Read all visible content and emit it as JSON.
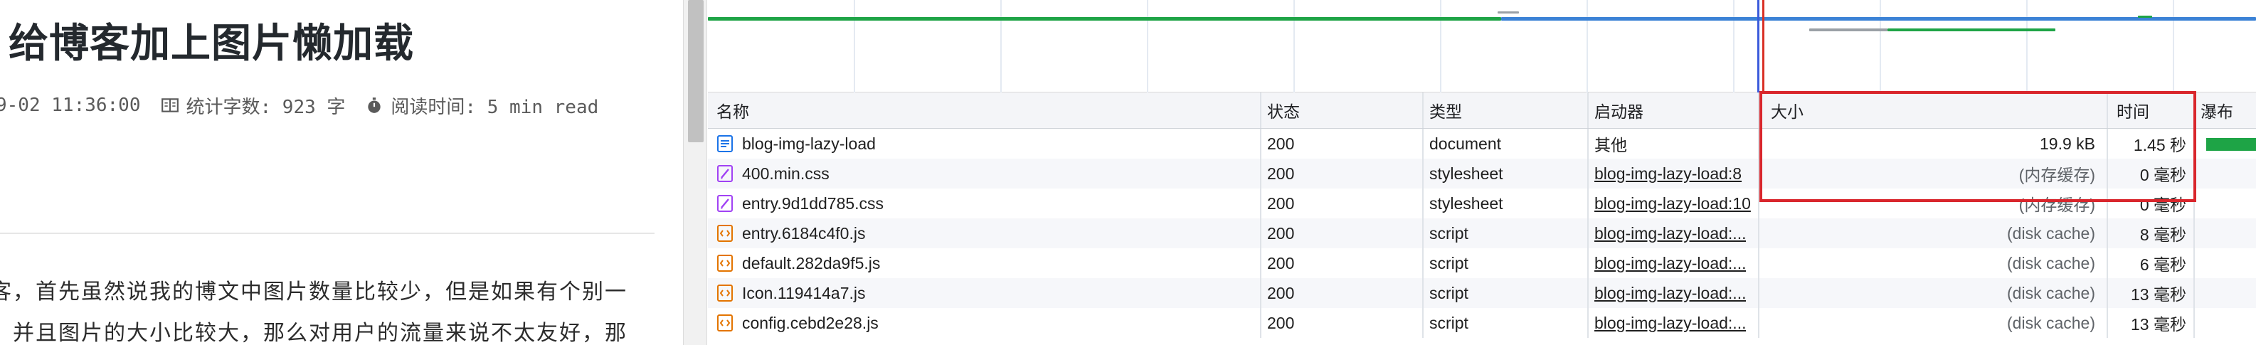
{
  "blog": {
    "title": "给博客加上图片懒加载",
    "meta": {
      "date": "9-02 11:36:00",
      "word_count": "统计字数: 923 字",
      "read_time": "阅读时间: 5 min read"
    },
    "paragraph": [
      "客，首先虽然说我的博文中图片数量比较少，但是如果有个别一",
      "，并且图片的大小比较大，那么对用户的流量来说不太友好，那"
    ]
  },
  "network": {
    "columns": {
      "name": "名称",
      "status": "状态",
      "type": "类型",
      "initiator": "启动器",
      "size": "大小",
      "time": "时间",
      "waterfall": "瀑布"
    },
    "rows": [
      {
        "name": "blog-img-lazy-load",
        "icon": "document-icon",
        "status": "200",
        "type": "document",
        "initiator": "其他",
        "initiator_link": false,
        "size": "19.9 kB",
        "time": "1.45 秒"
      },
      {
        "name": "400.min.css",
        "icon": "stylesheet-icon",
        "status": "200",
        "type": "stylesheet",
        "initiator": "blog-img-lazy-load:8",
        "initiator_link": true,
        "size": "(内存缓存)",
        "time": "0 毫秒"
      },
      {
        "name": "entry.9d1dd785.css",
        "icon": "stylesheet-icon",
        "status": "200",
        "type": "stylesheet",
        "initiator": "blog-img-lazy-load:10",
        "initiator_link": true,
        "size": "(内存缓存)",
        "time": "0 毫秒"
      },
      {
        "name": "entry.6184c4f0.js",
        "icon": "script-icon",
        "status": "200",
        "type": "script",
        "initiator": "blog-img-lazy-load:...",
        "initiator_link": true,
        "size": "(disk cache)",
        "time": "8 毫秒"
      },
      {
        "name": "default.282da9f5.js",
        "icon": "script-icon",
        "status": "200",
        "type": "script",
        "initiator": "blog-img-lazy-load:...",
        "initiator_link": true,
        "size": "(disk cache)",
        "time": "6 毫秒"
      },
      {
        "name": "Icon.119414a7.js",
        "icon": "script-icon",
        "status": "200",
        "type": "script",
        "initiator": "blog-img-lazy-load:...",
        "initiator_link": true,
        "size": "(disk cache)",
        "time": "13 毫秒"
      },
      {
        "name": "config.cebd2e28.js",
        "icon": "script-icon",
        "status": "200",
        "type": "script",
        "initiator": "blog-img-lazy-load:...",
        "initiator_link": true,
        "size": "(disk cache)",
        "time": "13 毫秒"
      }
    ]
  },
  "colors": {
    "highlight": "#d9262c",
    "waterfall_green": "#1ea446",
    "overview_blue": "#3b82d6",
    "doc_icon": "#1a73e8",
    "css_icon": "#a142f4",
    "js_icon": "#e37400"
  }
}
